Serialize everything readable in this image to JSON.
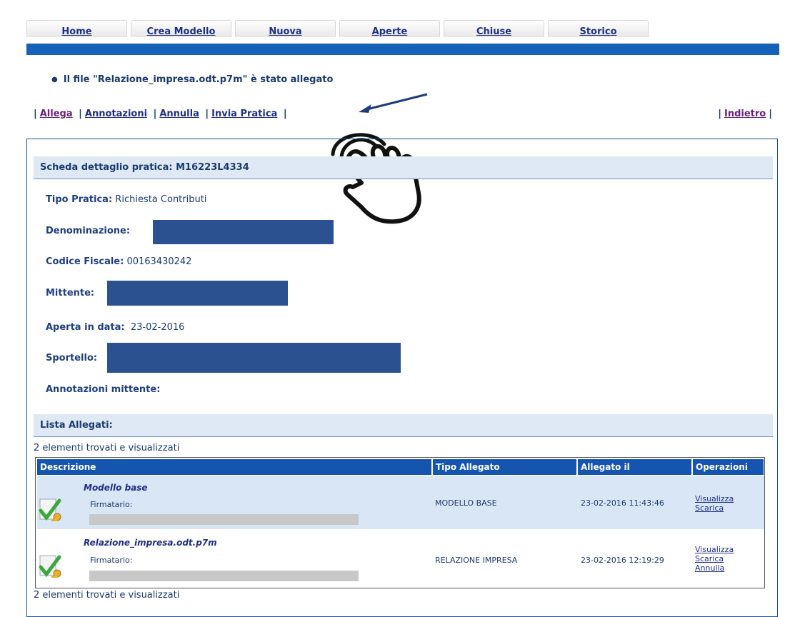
{
  "tabs": [
    "Home",
    "Crea Modello",
    "Nuova",
    "Aperte",
    "Chiuse",
    "Storico"
  ],
  "message": "Il file \"Relazione_impresa.odt.p7m\" è stato allegato",
  "actions": [
    "Allega",
    "Annotazioni",
    "Annulla",
    "Invia Pratica"
  ],
  "back_label": "Indietro",
  "detail": {
    "header": "Scheda dettaglio pratica: M16223L4334",
    "tipo_pratica_label": "Tipo Pratica:",
    "tipo_pratica_value": "Richiesta Contributi",
    "denominazione_label": "Denominazione:",
    "codice_fiscale_label": "Codice Fiscale:",
    "codice_fiscale_value": "00163430242",
    "mittente_label": "Mittente:",
    "aperta_label": "Aperta in data:",
    "aperta_value": "23-02-2016",
    "sportello_label": "Sportello:",
    "annotazioni_label": "Annotazioni mittente:"
  },
  "attachments": {
    "header": "Lista Allegati:",
    "count_text": "2 elementi trovati e visualizzati",
    "columns": [
      "Descrizione",
      "Tipo Allegato",
      "Allegato il",
      "Operazioni"
    ],
    "rows": [
      {
        "name": "Modello base",
        "signer_label": "Firmatario:",
        "type": "MODELLO BASE",
        "date": "23-02-2016 11:43:46",
        "ops": [
          "Visualizza",
          "Scarica"
        ]
      },
      {
        "name": "Relazione_impresa.odt.p7m",
        "signer_label": "Firmatario:",
        "type": "RELAZIONE IMPRESA",
        "date": "23-02-2016 12:19:29",
        "ops": [
          "Visualizza",
          "Scarica",
          "Annulla"
        ]
      }
    ]
  },
  "colors": {
    "accent": "#1563b8",
    "header_bg": "#dfe9f5",
    "row_highlight": "#d8e6f6",
    "redaction": "#2c5190"
  }
}
